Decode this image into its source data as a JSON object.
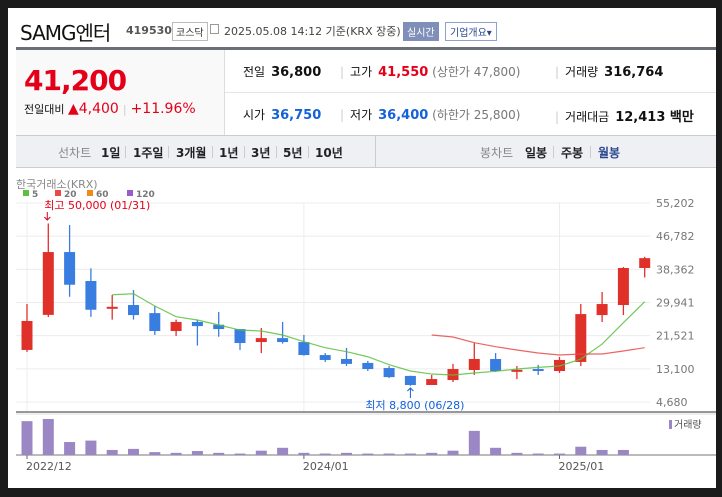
{
  "header": {
    "title": "SAMG엔터",
    "code": "419530",
    "market": "코스닥",
    "datetime": "2025.05.08 14:12 기준(KRX 장중)",
    "realtime_label": "실시간",
    "company_info_label": "기업개요▾"
  },
  "quote": {
    "price": "41,200",
    "change_label": "전일대비",
    "change": "▲4,400",
    "change_pct": "+11.96%",
    "prev_close_label": "전일",
    "prev_close": "36,800",
    "high_label": "고가",
    "high": "41,550",
    "upper_limit": "(상한가 47,800)",
    "volume_label": "거래량",
    "volume": "316,764",
    "open_label": "시가",
    "open": "36,750",
    "low_label": "저가",
    "low": "36,400",
    "lower_limit": "(하한가 25,800)",
    "amount_label": "거래대금",
    "amount": "12,413 백만"
  },
  "tabs": {
    "line_label": "선차트",
    "line": [
      "1일",
      "1주일",
      "3개월",
      "1년",
      "3년",
      "5년",
      "10년"
    ],
    "candle_label": "봉차트",
    "candle": [
      "일봉",
      "주봉",
      "월봉"
    ],
    "active": "월봉"
  },
  "colors": {
    "up": "#e0302a",
    "down": "#3a7de0",
    "ma5": "#5bbf3f",
    "ma20": "#e84a4a",
    "ma60": "#f08a1c",
    "ma120": "#9a5ccc",
    "volume": "#9b87c4",
    "active_tab": "#2d4a8f"
  },
  "chart_data": {
    "type": "candlestick",
    "source": "한국거래소(KRX)",
    "legend": [
      "5",
      "20",
      "60",
      "120"
    ],
    "y_ticks": [
      "55,202",
      "46,782",
      "38,362",
      "29,941",
      "21,521",
      "13,100",
      "4,680"
    ],
    "ylim": [
      4680,
      55202
    ],
    "x_labels": [
      {
        "index": 0,
        "label": "2022/12"
      },
      {
        "index": 13,
        "label": "2024/01"
      },
      {
        "index": 25,
        "label": "2025/01"
      }
    ],
    "high_annotation": {
      "index": 1,
      "label": "최고 50,000 (01/31)"
    },
    "low_annotation": {
      "index": 18,
      "label": "최저 8,800 (06/28)"
    },
    "candles": [
      [
        17900,
        29550,
        17400,
        25250
      ],
      [
        26800,
        50000,
        26250,
        42750
      ],
      [
        42750,
        49600,
        31400,
        34450
      ],
      [
        35400,
        38600,
        26300,
        28100
      ],
      [
        28350,
        31850,
        25600,
        28850
      ],
      [
        29300,
        33100,
        25600,
        26750
      ],
      [
        27250,
        29050,
        21700,
        22700
      ],
      [
        22700,
        25600,
        21450,
        25000
      ],
      [
        25000,
        25600,
        19000,
        23950
      ],
      [
        24300,
        27550,
        21250,
        23200
      ],
      [
        23200,
        23200,
        17900,
        19650
      ],
      [
        19900,
        23450,
        17100,
        20900
      ],
      [
        20900,
        25000,
        19500,
        19900
      ],
      [
        19900,
        21700,
        16450,
        16600
      ],
      [
        16600,
        17100,
        14850,
        15350
      ],
      [
        15600,
        18400,
        13800,
        14350
      ],
      [
        14600,
        15100,
        12550,
        13050
      ],
      [
        13300,
        13800,
        10750,
        11000
      ],
      [
        11300,
        11350,
        8800,
        9000
      ],
      [
        9000,
        11550,
        9000,
        10500
      ],
      [
        10250,
        14350,
        9750,
        13050
      ],
      [
        12800,
        19650,
        11550,
        15600
      ],
      [
        15600,
        17100,
        12300,
        12550
      ],
      [
        12700,
        13800,
        10500,
        12850
      ],
      [
        13050,
        14100,
        11550,
        12550
      ],
      [
        12550,
        16100,
        12050,
        15350
      ],
      [
        14850,
        29550,
        13800,
        27000
      ],
      [
        26750,
        32600,
        25000,
        29550
      ],
      [
        29300,
        38950,
        26750,
        38700
      ],
      [
        38700,
        41550,
        36300,
        41200
      ]
    ],
    "ma5": [
      null,
      null,
      null,
      null,
      31900,
      32170,
      29050,
      26330,
      25500,
      24230,
      22950,
      22700,
      21690,
      19990,
      18470,
      17450,
      16170,
      14160,
      12550,
      11780,
      11530,
      12050,
      12470,
      13050,
      13470,
      13820,
      15590,
      19390,
      24810,
      30150
    ],
    "ma20": [
      null,
      null,
      null,
      null,
      null,
      null,
      null,
      null,
      null,
      null,
      null,
      null,
      null,
      null,
      null,
      null,
      null,
      null,
      null,
      21690,
      21180,
      19740,
      18720,
      17880,
      17120,
      16610,
      16860,
      16860,
      17630,
      18470
    ],
    "volume_label": "거래량",
    "volume_relative": [
      94,
      100,
      36,
      40,
      14,
      17,
      8,
      6,
      11,
      6,
      4,
      12,
      20,
      6,
      4,
      6,
      4,
      4,
      4,
      6,
      12,
      67,
      20,
      6,
      4,
      4,
      23,
      14,
      14,
      0
    ]
  }
}
